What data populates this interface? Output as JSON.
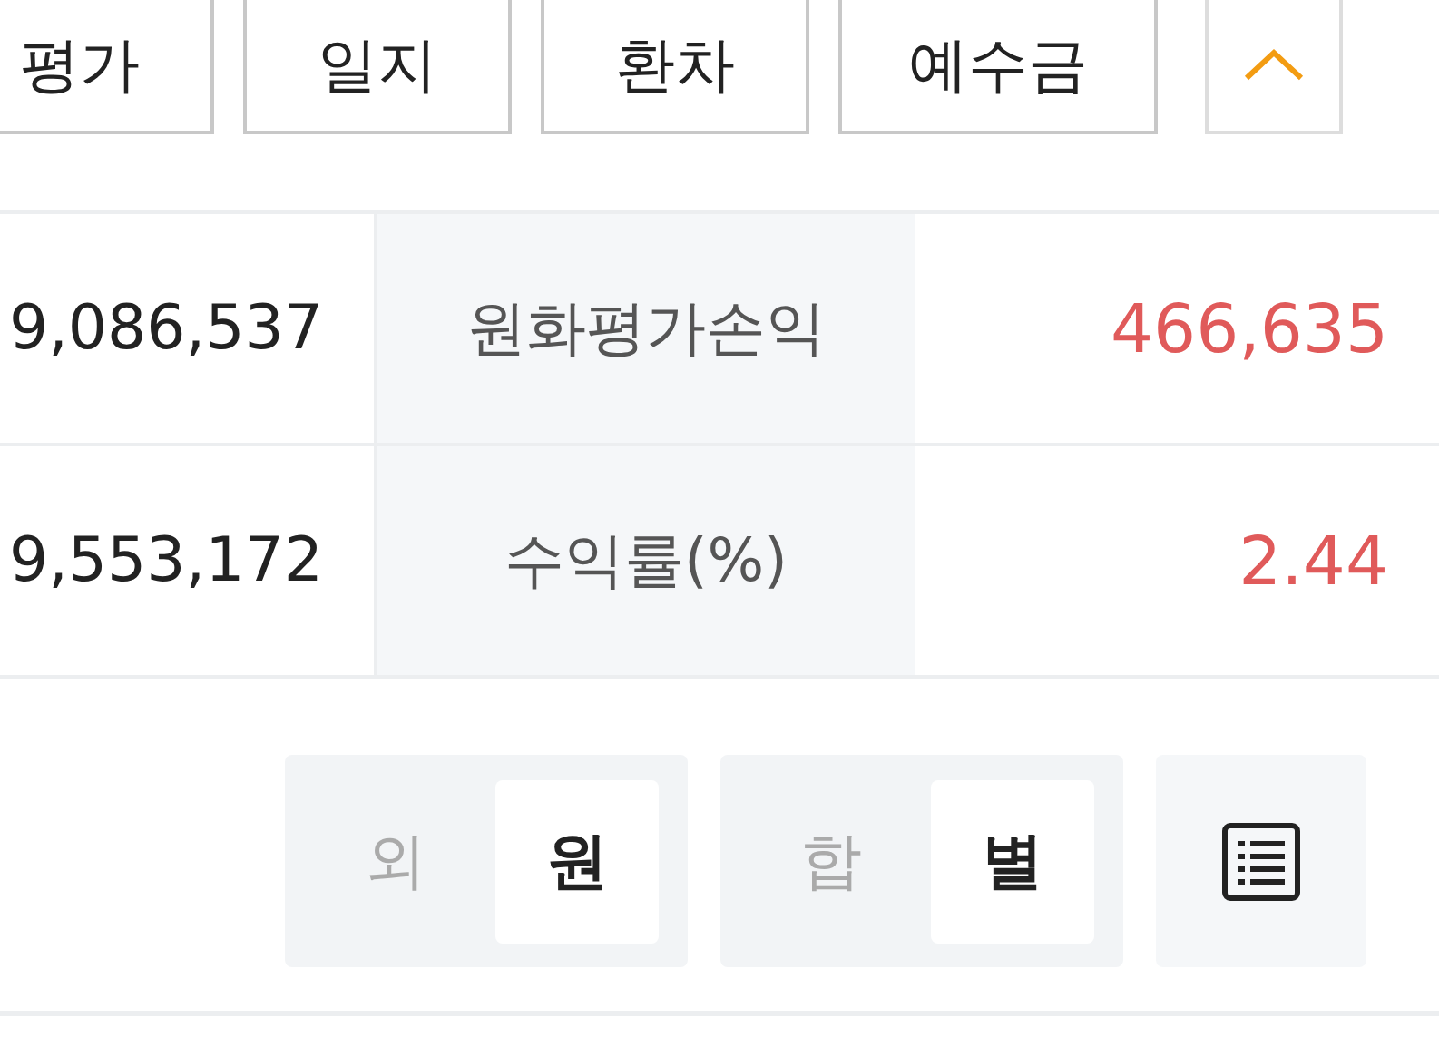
{
  "tabs": [
    {
      "label": "평가"
    },
    {
      "label": "일지"
    },
    {
      "label": "환차"
    },
    {
      "label": "예수금"
    }
  ],
  "collapse_button": {
    "expanded": true
  },
  "summary_rows": [
    {
      "left_value": "9,086,537",
      "label": "원화평가손익",
      "value": "466,635"
    },
    {
      "left_value": "9,553,172",
      "label": "수익률(%)",
      "value": "2.44"
    }
  ],
  "toggles": [
    {
      "options": [
        {
          "label": "외",
          "selected": false
        },
        {
          "label": "원",
          "selected": true
        }
      ]
    },
    {
      "options": [
        {
          "label": "합",
          "selected": false
        },
        {
          "label": "별",
          "selected": true
        }
      ]
    }
  ]
}
